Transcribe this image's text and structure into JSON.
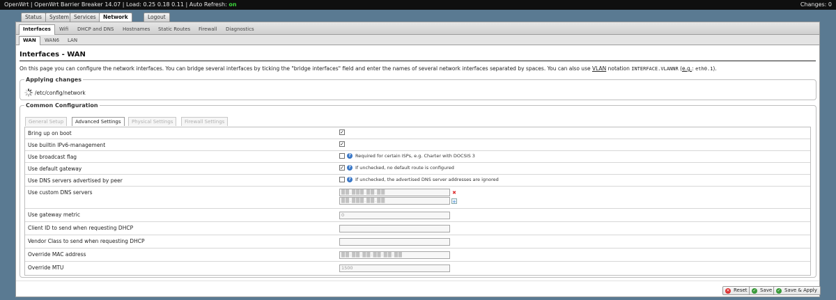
{
  "topbar": {
    "host": "OpenWrt",
    "firmware": "OpenWrt Barrier Breaker 14.07",
    "load": "Load: 0.25 0.18 0.11",
    "auto_refresh_label": "Auto Refresh:",
    "auto_refresh_value": "on",
    "changes": "Changes: 0"
  },
  "main_tabs": [
    {
      "label": "Status"
    },
    {
      "label": "System"
    },
    {
      "label": "Services"
    },
    {
      "label": "Network",
      "active": true
    },
    {
      "label": "Logout"
    }
  ],
  "sub_tabs": [
    {
      "label": "Interfaces",
      "active": true
    },
    {
      "label": "Wifi"
    },
    {
      "label": "DHCP and DNS"
    },
    {
      "label": "Hostnames"
    },
    {
      "label": "Static Routes"
    },
    {
      "label": "Firewall"
    },
    {
      "label": "Diagnostics"
    }
  ],
  "iface_tabs": [
    {
      "label": "WAN",
      "active": true
    },
    {
      "label": "WAN6"
    },
    {
      "label": "LAN"
    }
  ],
  "page": {
    "title": "Interfaces - WAN",
    "desc_prefix": "On this page you can configure the network interfaces. You can bridge several interfaces by ticking the \"bridge interfaces\" field and enter the names of several network interfaces separated by spaces. You can also use",
    "desc_vlan": "VLAN",
    "desc_notation": "notation",
    "desc_code": "INTERFACE.VLANNR",
    "desc_paren_open": "(",
    "desc_eg": "e.g.",
    "desc_colon": ":",
    "desc_code2": "eth0.1",
    "desc_suffix": ")."
  },
  "applying": {
    "legend": "Applying changes",
    "path": "/etc/config/network"
  },
  "common": {
    "legend": "Common Configuration",
    "tabs": [
      {
        "label": "General Setup",
        "active": false
      },
      {
        "label": "Advanced Settings",
        "active": true
      },
      {
        "label": "Physical Settings",
        "active": false
      },
      {
        "label": "Firewall Settings",
        "active": false
      }
    ],
    "rows": {
      "bring_up": {
        "label": "Bring up on boot",
        "checked": true
      },
      "ipv6_mgmt": {
        "label": "Use builtin IPv6-management",
        "checked": true
      },
      "broadcast": {
        "label": "Use broadcast flag",
        "checked": false,
        "hint": "Required for certain ISPs, e.g. Charter with DOCSIS 3"
      },
      "default_gw": {
        "label": "Use default gateway",
        "checked": true,
        "hint": "If unchecked, no default route is configured"
      },
      "peer_dns": {
        "label": "Use DNS servers advertised by peer",
        "checked": false,
        "hint": "If unchecked, the advertised DNS server addresses are ignored"
      },
      "custom_dns": {
        "label": "Use custom DNS servers",
        "value1": "██.███.██.██",
        "value2": "██.███.██.██"
      },
      "gw_metric": {
        "label": "Use gateway metric",
        "placeholder": "0"
      },
      "client_id": {
        "label": "Client ID to send when requesting DHCP",
        "value": ""
      },
      "vendor_class": {
        "label": "Vendor Class to send when requesting DHCP",
        "value": ""
      },
      "mac": {
        "label": "Override MAC address",
        "value": "██:██:██:██:██:██"
      },
      "mtu": {
        "label": "Override MTU",
        "placeholder": "1500"
      }
    }
  },
  "buttons": {
    "reset": "Reset",
    "save": "Save",
    "save_apply": "Save & Apply"
  },
  "colors": {
    "accent": "#2f7fd0",
    "background": "#5a7a92",
    "auto_refresh_on": "#3bd43b"
  }
}
